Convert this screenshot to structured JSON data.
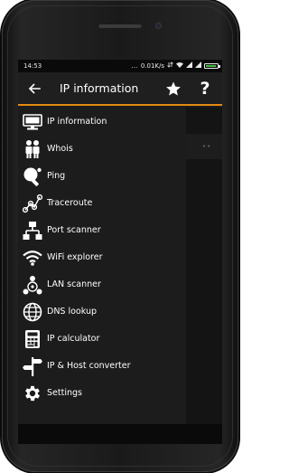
{
  "status_bar": {
    "time": "14:53",
    "network_speed": "0.01K/s",
    "battery_color": "#3ec13e",
    "battery_level": 0.95
  },
  "app_bar": {
    "title": "IP information",
    "back_icon": "arrow-left-icon",
    "star_icon": "star-icon",
    "help_label": "?",
    "accent_color": "#e38a12"
  },
  "content": {
    "dots": "••"
  },
  "drawer": {
    "items": [
      {
        "label": "IP information",
        "icon": "monitor-icon"
      },
      {
        "label": "Whois",
        "icon": "people-icon"
      },
      {
        "label": "Ping",
        "icon": "ping-pong-icon"
      },
      {
        "label": "Traceroute",
        "icon": "traceroute-icon"
      },
      {
        "label": "Port scanner",
        "icon": "network-tree-icon"
      },
      {
        "label": "WiFi explorer",
        "icon": "wifi-icon"
      },
      {
        "label": "LAN scanner",
        "icon": "lan-icon"
      },
      {
        "label": "DNS lookup",
        "icon": "globe-icon"
      },
      {
        "label": "IP calculator",
        "icon": "calculator-icon"
      },
      {
        "label": "IP & Host converter",
        "icon": "signpost-icon"
      },
      {
        "label": "Settings",
        "icon": "gear-icon"
      }
    ]
  }
}
